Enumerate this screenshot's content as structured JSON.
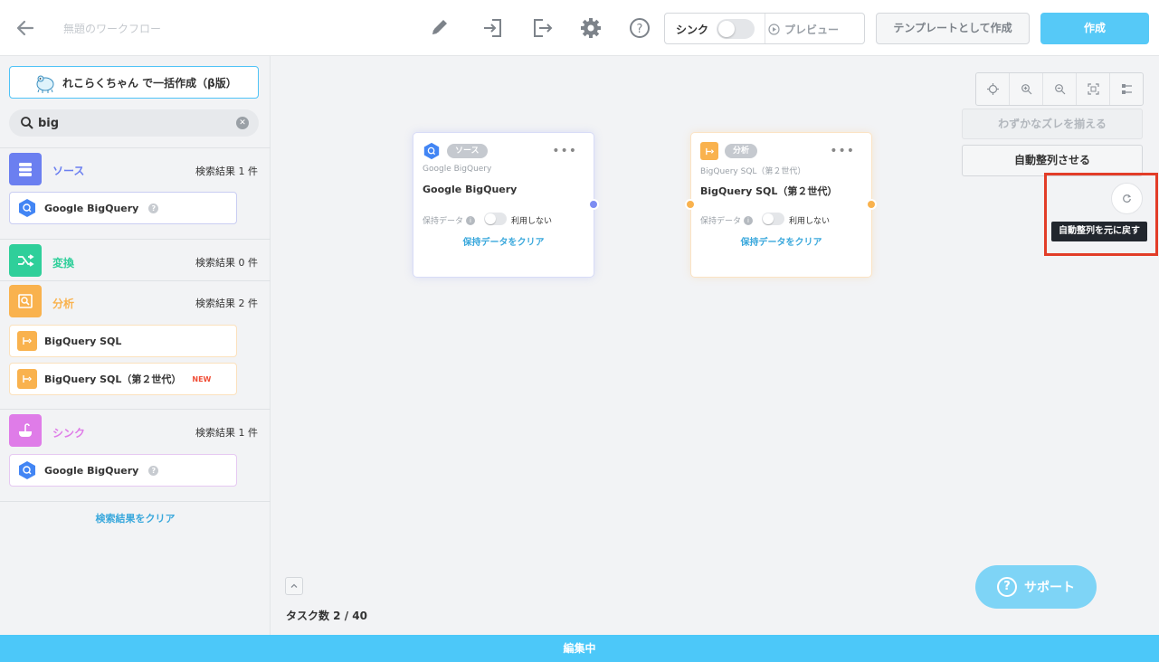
{
  "header": {
    "workflow_name": "無題のワークフロー",
    "sync_label": "シンク",
    "preview_label": "プレビュー",
    "template_label": "テンプレートとして作成",
    "create_label": "作成"
  },
  "sidebar": {
    "bulk_create_label": "れこらくちゃん で一括作成（β版）",
    "search_value": "big",
    "categories": [
      {
        "name": "ソース",
        "count": "検索結果 1 件",
        "color": "#6b7ff0"
      },
      {
        "name": "変換",
        "count": "検索結果 0 件",
        "color": "#2fcf9a"
      },
      {
        "name": "分析",
        "count": "検索結果 2 件",
        "color": "#f9b24e"
      },
      {
        "name": "シンク",
        "count": "検索結果 1 件",
        "color": "#df7ce8"
      }
    ],
    "source_items": [
      {
        "label": "Google BigQuery"
      }
    ],
    "analysis_items": [
      {
        "label": "BigQuery SQL"
      },
      {
        "label": "BigQuery SQL（第２世代）",
        "badge": "NEW"
      }
    ],
    "sink_items": [
      {
        "label": "Google BigQuery"
      }
    ],
    "clear_results": "検索結果をクリア"
  },
  "canvas": {
    "nodes": [
      {
        "badge": "ソース",
        "subtitle": "Google BigQuery",
        "title": "Google BigQuery",
        "keep_label": "保持データ",
        "toggle_label": "利用しない",
        "clear_label": "保持データをクリア"
      },
      {
        "badge": "分析",
        "subtitle": "BigQuery SQL（第２世代）",
        "title": "BigQuery SQL（第２世代）",
        "keep_label": "保持データ",
        "toggle_label": "利用しない",
        "clear_label": "保持データをクリア"
      }
    ],
    "align_small_label": "わずかなズレを揃える",
    "auto_align_label": "自動整列させる",
    "undo_tooltip": "自動整列を元に戻す",
    "task_count": "タスク数 2 / 40",
    "support_label": "サポート"
  },
  "footer": {
    "status": "編集中"
  }
}
